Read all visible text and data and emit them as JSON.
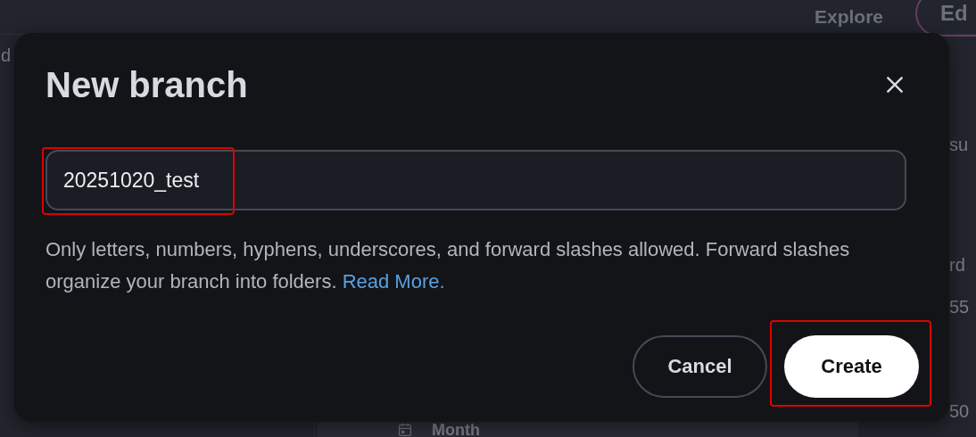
{
  "background": {
    "nav_links": [
      "Explore"
    ],
    "nav_button": "Ed",
    "left_fragment": "d",
    "right_fragments": [
      "su",
      "rd",
      "55",
      "50"
    ],
    "period_label": "Month"
  },
  "dialog": {
    "title": "New branch",
    "branch_name": {
      "value": "20251020_test",
      "highlighted": true
    },
    "help_text": "Only letters, numbers, hyphens, underscores, and forward slashes allowed. Forward slashes organize your branch into folders.",
    "help_link": "Read More.",
    "buttons": [
      {
        "label": "Cancel",
        "kind": "secondary",
        "highlighted": false
      },
      {
        "label": "Create",
        "kind": "primary",
        "highlighted": true
      }
    ]
  }
}
